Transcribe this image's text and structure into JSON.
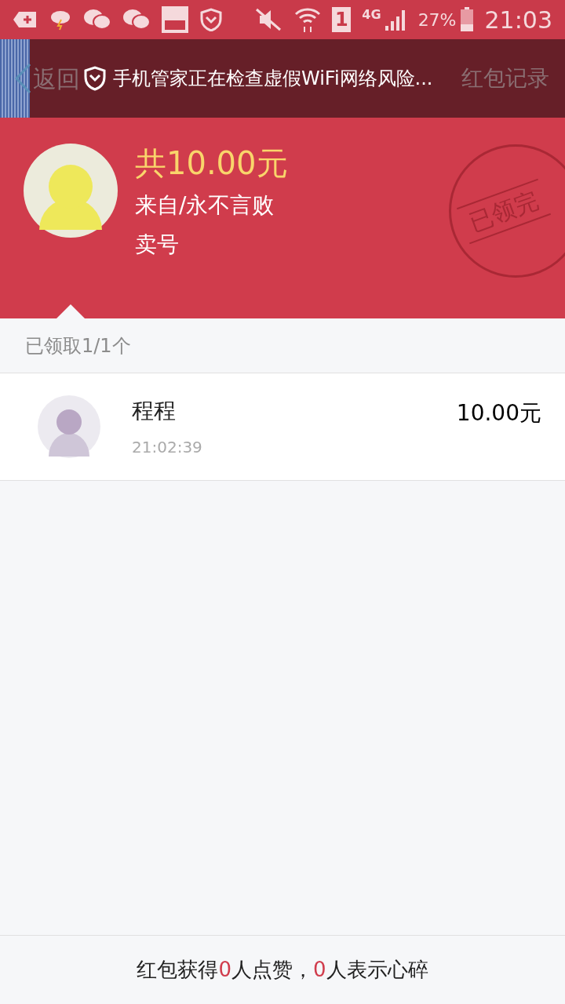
{
  "status_bar": {
    "sim": "1",
    "network": "4G",
    "battery": "27%",
    "time": "21:03"
  },
  "header": {
    "back": "返回",
    "notice": "手机管家正在检查虚假WiFi网络风险...",
    "record": "红包记录"
  },
  "packet": {
    "total": "共10.00元",
    "from": "来自/永不言败",
    "message": "卖号",
    "stamp": "已领完"
  },
  "summary": "已领取1/1个",
  "receivers": [
    {
      "name": "程程",
      "time": "21:02:39",
      "amount": "10.00元"
    }
  ],
  "footer": [
    {
      "text": "红包获得",
      "kind": "plain"
    },
    {
      "text": "0",
      "kind": "count"
    },
    {
      "text": "人点赞，",
      "kind": "plain"
    },
    {
      "text": "0",
      "kind": "count"
    },
    {
      "text": "人表示心碎",
      "kind": "plain"
    }
  ]
}
